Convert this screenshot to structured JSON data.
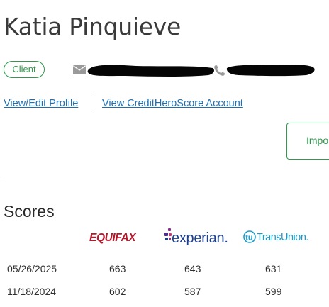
{
  "client": {
    "name": "Katia Pinquieve",
    "status_badge": "Client"
  },
  "contact": {
    "email_icon": "mail-icon",
    "email_redacted": true,
    "phone_icon": "phone-icon",
    "phone_redacted": true
  },
  "links": {
    "view_edit_profile": "View/Edit Profile",
    "view_account": "View CreditHeroScore Account"
  },
  "actions": {
    "import_label": "Impo"
  },
  "scores": {
    "title": "Scores",
    "bureaus": [
      {
        "name": "EQUIFAX",
        "color": "#b5172b"
      },
      {
        "name": "experian.",
        "color": "#1d3f8f",
        "accent": "#8a2a8c"
      },
      {
        "name": "TransUnion.",
        "color": "#1a9ccb"
      }
    ],
    "rows": [
      {
        "date": "05/26/2025",
        "equifax": "663",
        "experian": "643",
        "transunion": "631"
      },
      {
        "date": "11/18/2024",
        "equifax": "602",
        "experian": "587",
        "transunion": "599"
      }
    ]
  },
  "colors": {
    "brand_green": "#2e9a4c",
    "link_blue": "#1f6fb0"
  }
}
